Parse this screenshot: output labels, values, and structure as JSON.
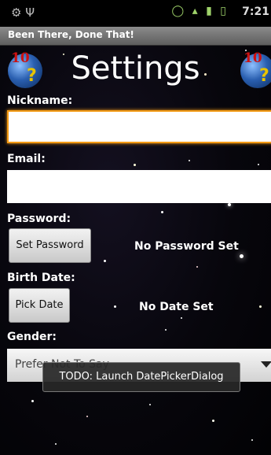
{
  "status_bar": {
    "left_icons": [
      "android-debug-icon",
      "usb-icon"
    ],
    "right_icons": [
      "alarm-icon",
      "wifi-icon",
      "signal-icon",
      "battery-icon",
      "clock-icon"
    ],
    "time": "7:21"
  },
  "app": {
    "title": "Been There, Done That!"
  },
  "header": {
    "title": "Settings",
    "logo_number": "10",
    "logo_mark": "?"
  },
  "form": {
    "nickname_label": "Nickname:",
    "nickname_value": "",
    "email_label": "Email:",
    "email_value": "",
    "password_label": "Password:",
    "password_button": "Set Password",
    "password_status": "No Password Set",
    "birthdate_label": "Birth Date:",
    "birthdate_button": "Pick Date",
    "birthdate_status": "No Date Set",
    "gender_label": "Gender:",
    "gender_selected": "Prefer Not To Say"
  },
  "toast": {
    "message": "TODO: Launch DatePickerDialog"
  },
  "colors": {
    "focus": "#f39a15",
    "titlebar": "#707070",
    "background": "#05050a"
  }
}
